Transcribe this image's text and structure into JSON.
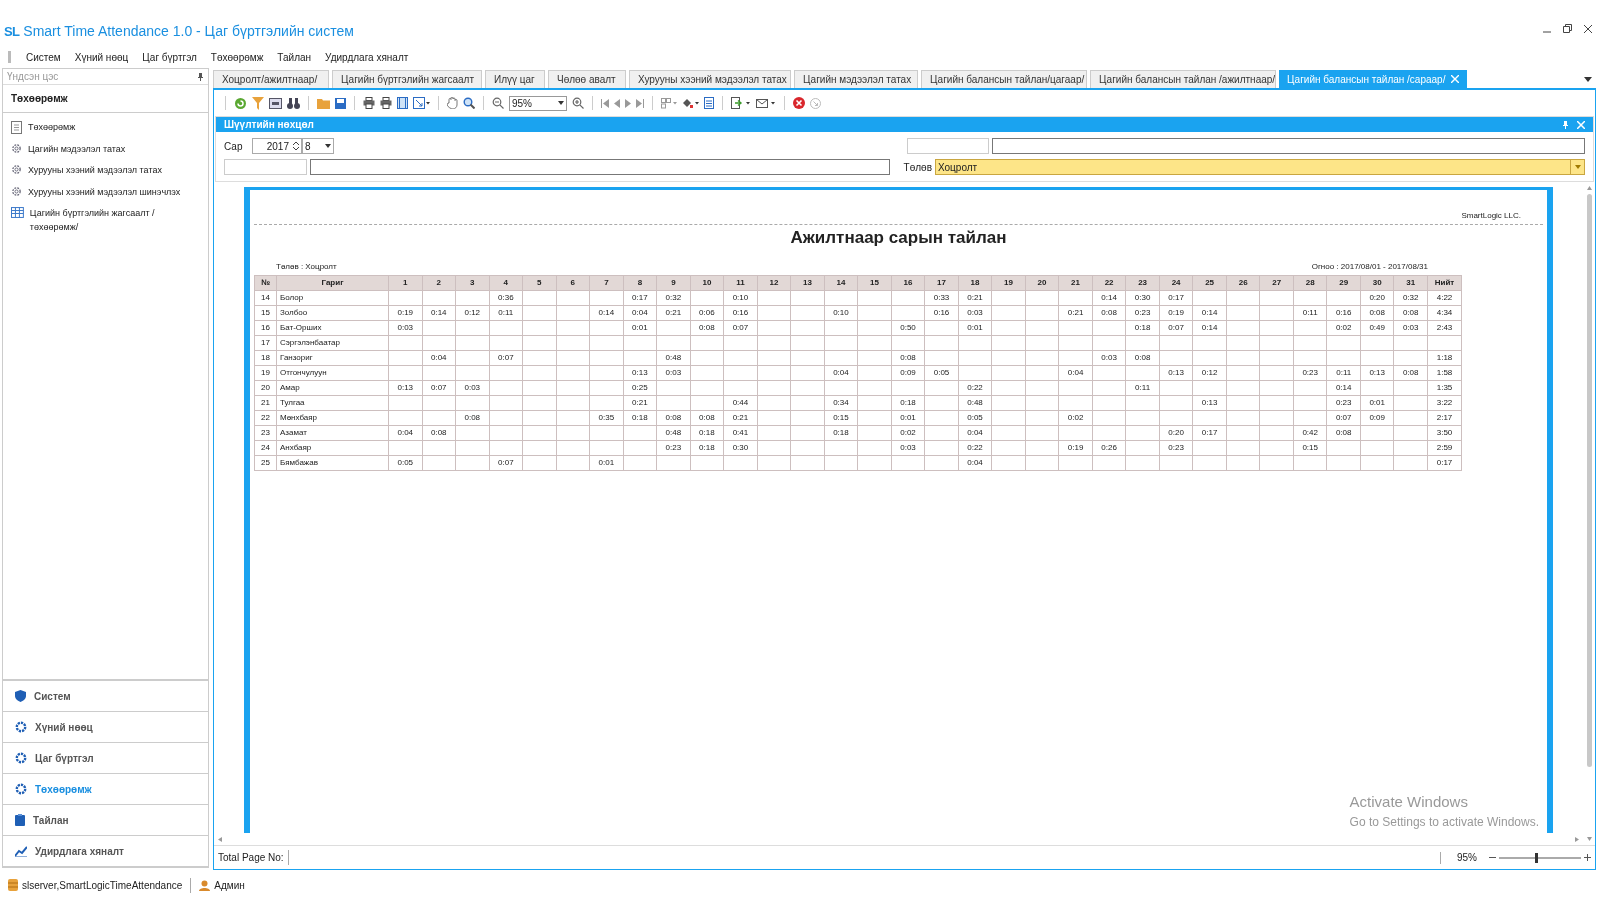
{
  "window": {
    "logo": "SL",
    "title": "Smart Time Attendance 1.0 - Цаг бүртгэлийн систем"
  },
  "menu": [
    "Систем",
    "Хүний нөөц",
    "Цаг бүртгэл",
    "Төхөөрөмж",
    "Тайлан",
    "Удирдлага хяналт"
  ],
  "sidebar": {
    "header": "Үндсэн цэс",
    "section": "Төхөөрөмж",
    "items": [
      {
        "label": "Төхөөрөмж"
      },
      {
        "label": "Цагийн мэдээлэл татах"
      },
      {
        "label": "Хурууны хээний мэдээлэл татах"
      },
      {
        "label": "Хурууны хээний мэдээлэл шинэчлэх"
      },
      {
        "label": "Цагийн бүртгэлийн жагсаалт /төхөөрөмж/"
      }
    ],
    "nav": [
      {
        "label": "Систем",
        "selected": false
      },
      {
        "label": "Хүний нөөц",
        "selected": false
      },
      {
        "label": "Цаг бүртгэл",
        "selected": false
      },
      {
        "label": "Төхөөрөмж",
        "selected": true
      },
      {
        "label": "Тайлан",
        "selected": false
      },
      {
        "label": "Удирдлага хяналт",
        "selected": false
      }
    ]
  },
  "tabs": [
    {
      "label": "Хоцролт/ажилтнаар/",
      "selected": false
    },
    {
      "label": "Цагийн бүртгэлийн жагсаалт",
      "selected": false
    },
    {
      "label": "Илүү цаг",
      "selected": false
    },
    {
      "label": "Чөлөө авалт",
      "selected": false
    },
    {
      "label": "Хурууны хээний мэдээлэл татах",
      "selected": false
    },
    {
      "label": "Цагийн мэдээлэл татах",
      "selected": false
    },
    {
      "label": "Цагийн балансын тайлан/цагаар/",
      "selected": false
    },
    {
      "label": "Цагийн балансын тайлан /ажилтнаар/",
      "selected": false
    },
    {
      "label": "Цагийн балансын тайлан /сараар/",
      "selected": true
    }
  ],
  "toolbar": {
    "zoom": "95%"
  },
  "filter": {
    "title": "Шүүлтийн нөхцөл",
    "month_label": "Сар",
    "year": "2017",
    "month": "8",
    "status_label": "Төлөв",
    "status": "Хоцролт"
  },
  "report": {
    "company": "SmartLogic LLC.",
    "title": "Ажилтнаар сарын тайлан",
    "status_line": "Төлөв : Хоцролт",
    "date_line": "Огноо : 2017/08/01 - 2017/08/31",
    "columns": {
      "number": "№",
      "name": "Гариг",
      "days": [
        "1",
        "2",
        "3",
        "4",
        "5",
        "6",
        "7",
        "8",
        "9",
        "10",
        "11",
        "12",
        "13",
        "14",
        "15",
        "16",
        "17",
        "18",
        "19",
        "20",
        "21",
        "22",
        "23",
        "24",
        "25",
        "26",
        "27",
        "28",
        "29",
        "30",
        "31"
      ],
      "total": "Нийт"
    },
    "rows": [
      {
        "number": "14",
        "name": "Болор",
        "times": {
          "4": "0:36",
          "8": "0:17",
          "9": "0:32",
          "11": "0:10",
          "17": "0:33",
          "18": "0:21",
          "22": "0:14",
          "23": "0:30",
          "24": "0:17",
          "30": "0:20",
          "31": "0:32"
        },
        "total": "4:22"
      },
      {
        "number": "15",
        "name": "Золбоо",
        "times": {
          "1": "0:19",
          "2": "0:14",
          "3": "0:12",
          "4": "0:11",
          "7": "0:14",
          "8": "0:04",
          "9": "0:21",
          "10": "0:06",
          "11": "0:16",
          "14": "0:10",
          "17": "0:16",
          "18": "0:03",
          "21": "0:21",
          "22": "0:08",
          "23": "0:23",
          "24": "0:19",
          "25": "0:14",
          "28": "0:11",
          "29": "0:16",
          "30": "0:08",
          "31": "0:08"
        },
        "total": "4:34"
      },
      {
        "number": "16",
        "name": "Бат-Орших",
        "times": {
          "1": "0:03",
          "8": "0:01",
          "10": "0:08",
          "11": "0:07",
          "16": "0:50",
          "18": "0:01",
          "23": "0:18",
          "24": "0:07",
          "25": "0:14",
          "29": "0:02",
          "30": "0:49",
          "31": "0:03"
        },
        "total": "2:43"
      },
      {
        "number": "17",
        "name": "Сэргэлэнбаатар",
        "times": {}
      },
      {
        "number": "18",
        "name": "Ганзориг",
        "times": {
          "2": "0:04",
          "4": "0:07",
          "9": "0:48",
          "16": "0:08",
          "22": "0:03",
          "23": "0:08"
        },
        "total": "1:18"
      },
      {
        "number": "19",
        "name": "Отгончулуун",
        "times": {
          "8": "0:13",
          "9": "0:03",
          "14": "0:04",
          "16": "0:09",
          "17": "0:05",
          "21": "0:04",
          "24": "0:13",
          "25": "0:12",
          "28": "0:23",
          "29": "0:11",
          "30": "0:13",
          "31": "0:08"
        },
        "total": "1:58"
      },
      {
        "number": "20",
        "name": "Амар",
        "times": {
          "1": "0:13",
          "2": "0:07",
          "3": "0:03",
          "8": "0:25",
          "18": "0:22",
          "23": "0:11",
          "29": "0:14"
        },
        "total": "1:35"
      },
      {
        "number": "21",
        "name": "Тулгаа",
        "times": {
          "8": "0:21",
          "11": "0:44",
          "14": "0:34",
          "16": "0:18",
          "18": "0:48",
          "25": "0:13",
          "29": "0:23",
          "30": "0:01"
        },
        "total": "3:22"
      },
      {
        "number": "22",
        "name": "Мөнхбаяр",
        "times": {
          "3": "0:08",
          "7": "0:35",
          "8": "0:18",
          "9": "0:08",
          "10": "0:08",
          "11": "0:21",
          "14": "0:15",
          "16": "0:01",
          "18": "0:05",
          "21": "0:02",
          "29": "0:07",
          "30": "0:09"
        },
        "total": "2:17"
      },
      {
        "number": "23",
        "name": "Азамат",
        "times": {
          "1": "0:04",
          "2": "0:08",
          "9": "0:48",
          "10": "0:18",
          "11": "0:41",
          "14": "0:18",
          "16": "0:02",
          "18": "0:04",
          "24": "0:20",
          "25": "0:17",
          "28": "0:42",
          "29": "0:08"
        },
        "total": "3:50"
      },
      {
        "number": "24",
        "name": "Анхбаяр",
        "times": {
          "9": "0:23",
          "10": "0:18",
          "11": "0:30",
          "16": "0:03",
          "18": "0:22",
          "21": "0:19",
          "22": "0:26",
          "24": "0:23",
          "28": "0:15"
        },
        "total": "2:59"
      },
      {
        "number": "25",
        "name": "Бямбажав",
        "times": {
          "1": "0:05",
          "4": "0:07",
          "7": "0:01",
          "18": "0:04"
        },
        "total": "0:17"
      }
    ]
  },
  "footer": {
    "pages_label": "Total Page No:",
    "zoom": "95%",
    "zoom_slider": {
      "level": 0.45
    }
  },
  "activation": {
    "title": "Activate Windows",
    "hint": "Go to Settings to activate Windows."
  },
  "status_bar": {
    "server": "slserver,SmartLogicTimeAttendance",
    "user": "Админ"
  }
}
